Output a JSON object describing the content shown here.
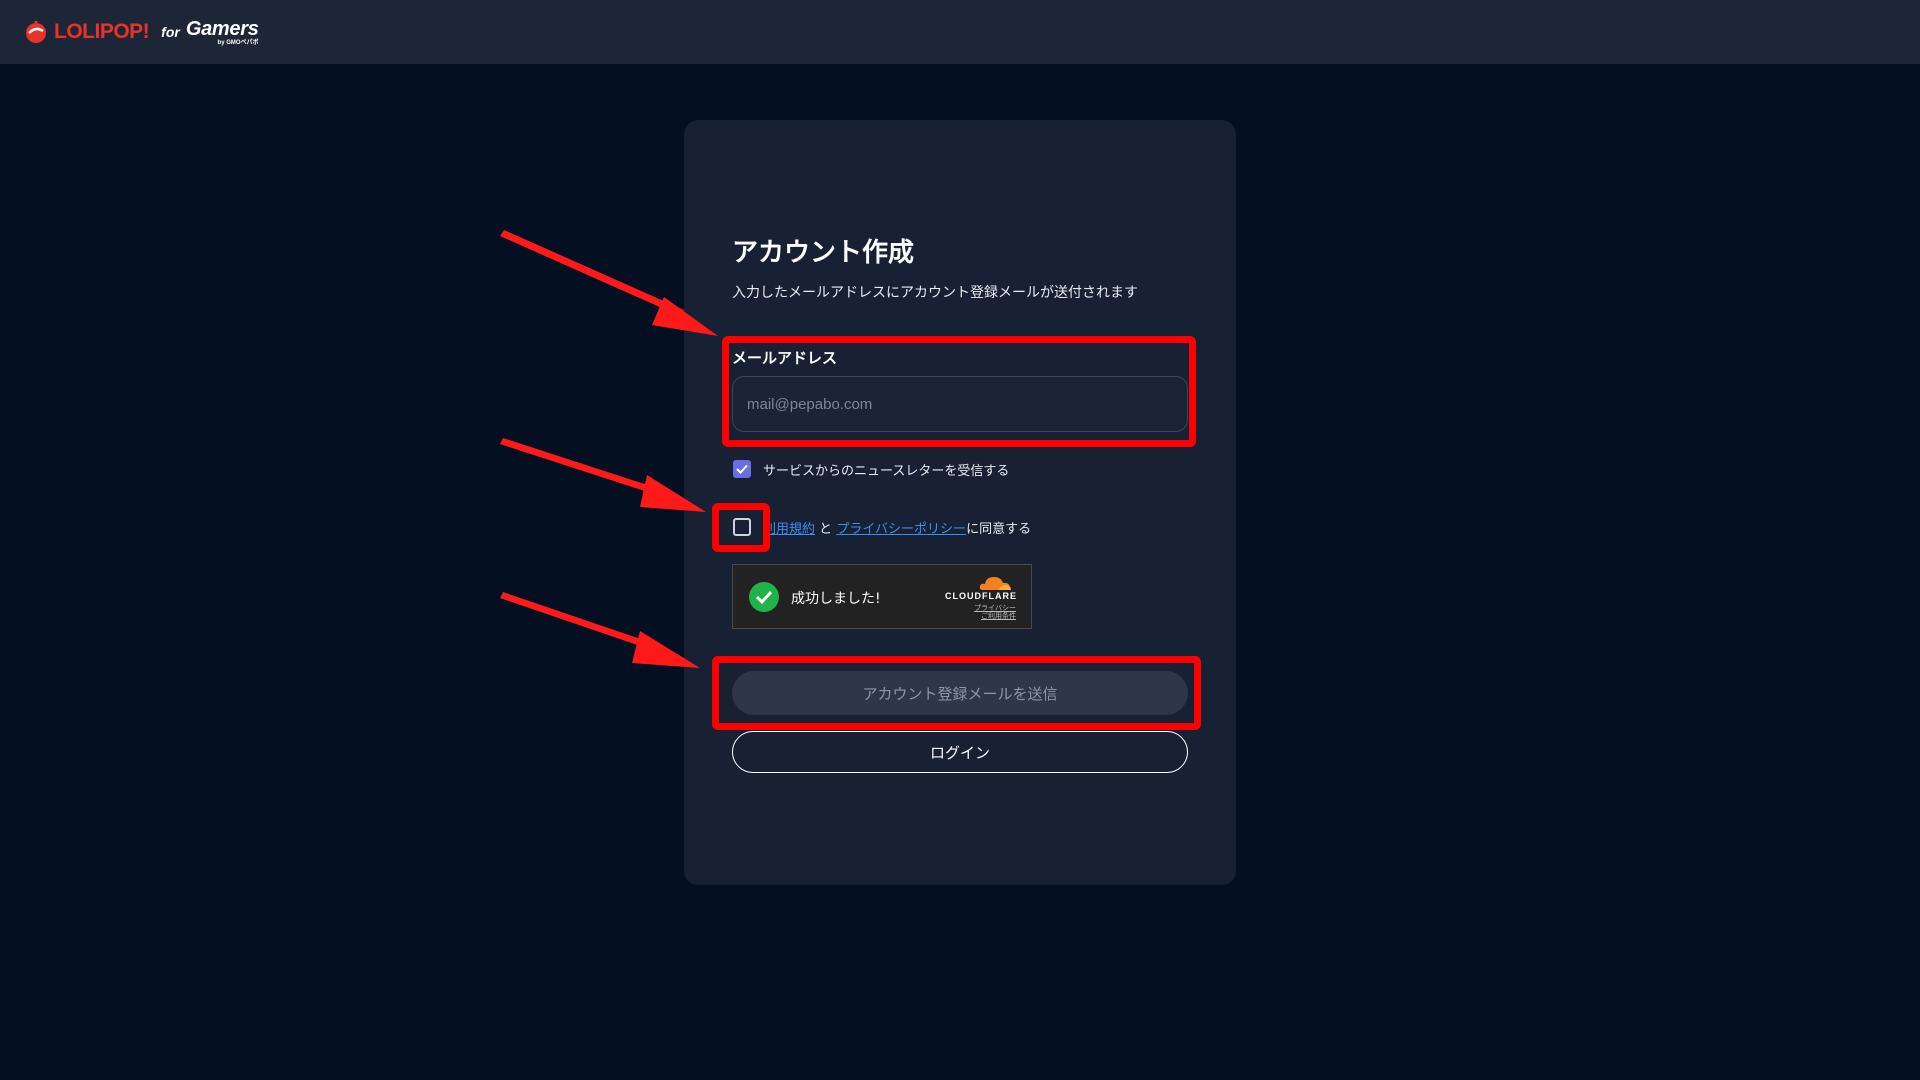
{
  "header": {
    "logo_main": "LOLIPOP!",
    "logo_for": "for",
    "logo_gamers": "Gamers",
    "logo_by": "by GMOペパボ"
  },
  "form": {
    "title": "アカウント作成",
    "subtitle": "入力したメールアドレスにアカウント登録メールが送付されます",
    "email_label": "メールアドレス",
    "email_placeholder": "mail@pepabo.com",
    "email_value": "",
    "newsletter_label": "サービスからのニュースレターを受信する",
    "newsletter_checked": true,
    "terms_link": "利用規約",
    "terms_and": "と",
    "privacy_link": "プライバシーポリシー",
    "terms_suffix": "に同意する",
    "terms_checked": false,
    "send_button": "アカウント登録メールを送信",
    "login_button": "ログイン"
  },
  "turnstile": {
    "status": "成功しました!",
    "brand": "CLOUDFLARE",
    "privacy": "プライバシー",
    "terms": "ご利用条件"
  },
  "colors": {
    "background": "#050f22",
    "card": "#172133",
    "highlight": "#ff0000",
    "checkbox_accent": "#6a6ee0",
    "link": "#3d8ef0",
    "logo_red": "#e8322a"
  }
}
